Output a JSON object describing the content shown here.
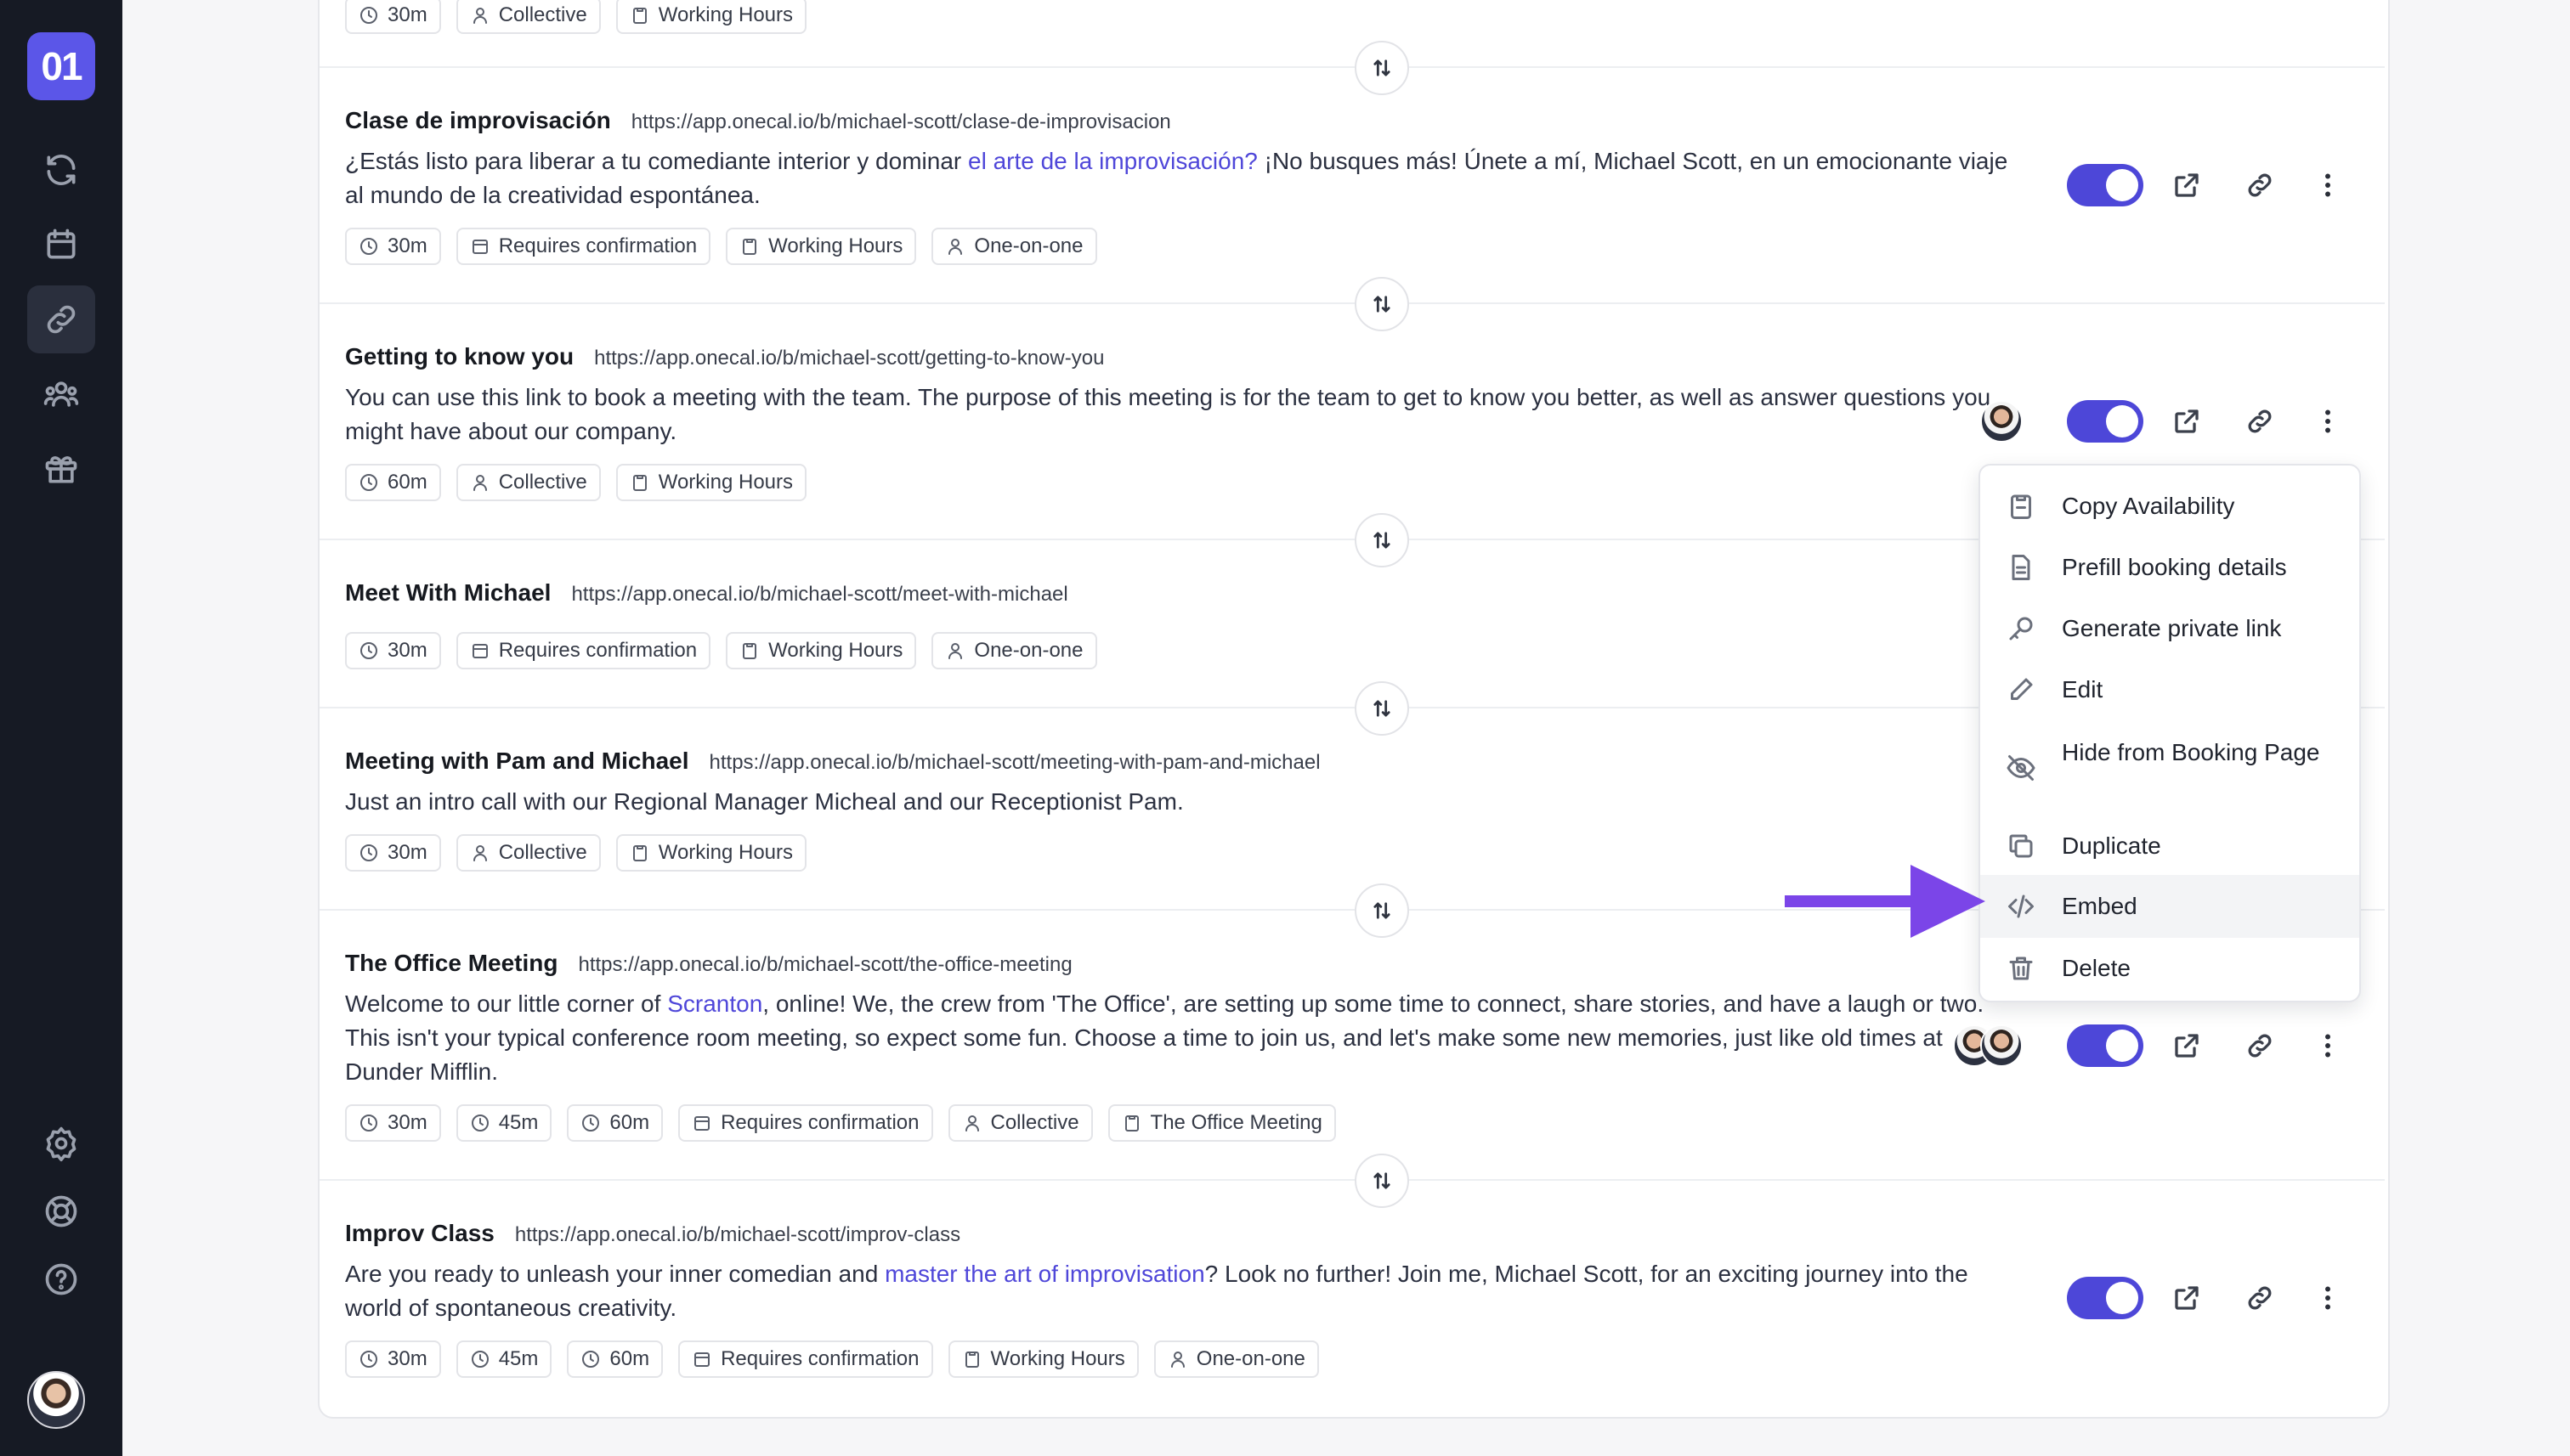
{
  "sidebar": {
    "logo_text": "01",
    "items": [
      {
        "name": "sync",
        "icon": "refresh-icon"
      },
      {
        "name": "calendar",
        "icon": "calendar-icon"
      },
      {
        "name": "links",
        "icon": "link-icon",
        "active": true
      },
      {
        "name": "teams",
        "icon": "users-icon"
      },
      {
        "name": "gifts",
        "icon": "gift-icon"
      }
    ],
    "bottom_items": [
      {
        "name": "settings",
        "icon": "gear-icon"
      },
      {
        "name": "support",
        "icon": "lifebuoy-icon"
      },
      {
        "name": "help",
        "icon": "question-icon"
      }
    ]
  },
  "top_partial_event": {
    "tags": [
      "30m",
      "Collective",
      "Working Hours"
    ]
  },
  "events": [
    {
      "title": "Clase de improvisación",
      "url": "https://app.onecal.io/b/michael-scott/clase-de-improvisacion",
      "desc_1": "¿Estás listo para liberar a tu comediante interior y dominar ",
      "desc_link": "el arte de la improvisación?",
      "desc_2": " ¡No busques más! Únete a mí, Michael Scott, en un emocionante viaje al mundo de la creatividad espontánea.",
      "tags": [
        "30m",
        "Requires confirmation",
        "Working Hours",
        "One-on-one"
      ]
    },
    {
      "title": "Getting to know you",
      "url": "https://app.onecal.io/b/michael-scott/getting-to-know-you",
      "desc_1": "You can use this link to book a meeting with the team. The purpose of this meeting is for the team to get to know you better, as well as answer questions you might have about our company.",
      "tags": [
        "60m",
        "Collective",
        "Working Hours"
      ]
    },
    {
      "title": "Meet With Michael",
      "url": "https://app.onecal.io/b/michael-scott/meet-with-michael",
      "tags": [
        "30m",
        "Requires confirmation",
        "Working Hours",
        "One-on-one"
      ]
    },
    {
      "title": "Meeting with Pam and Michael",
      "url": "https://app.onecal.io/b/michael-scott/meeting-with-pam-and-michael",
      "desc_1": "Just an intro call with our Regional Manager Micheal and our Receptionist Pam.",
      "tags": [
        "30m",
        "Collective",
        "Working Hours"
      ]
    },
    {
      "title": "The Office Meeting",
      "url": "https://app.onecal.io/b/michael-scott/the-office-meeting",
      "desc_1": "Welcome to our little corner of ",
      "desc_link": "Scranton",
      "desc_2": ", online! We, the crew from 'The Office', are setting up some time to connect, share stories, and have a laugh or two. This isn't your typical conference room meeting, so expect some fun. Choose a time to join us, and let's make some new memories, just like old times at Dunder Mifflin.",
      "tags": [
        "30m",
        "45m",
        "60m",
        "Requires confirmation",
        "Collective",
        "The Office Meeting"
      ]
    },
    {
      "title": "Improv Class",
      "url": "https://app.onecal.io/b/michael-scott/improv-class",
      "desc_1": "Are you ready to unleash your inner comedian and ",
      "desc_link": "master the art of improvisation",
      "desc_2": "? Look no further! Join me, Michael Scott, for an exciting journey into the world of spontaneous creativity.",
      "tags": [
        "30m",
        "45m",
        "60m",
        "Requires confirmation",
        "Working Hours",
        "One-on-one"
      ]
    }
  ],
  "context_menu": {
    "items": [
      {
        "label": "Copy Availability",
        "icon": "clipboard-icon"
      },
      {
        "label": "Prefill booking details",
        "icon": "document-icon"
      },
      {
        "label": "Generate private link",
        "icon": "key-icon"
      },
      {
        "label": "Edit",
        "icon": "pencil-icon"
      },
      {
        "label": "Hide from Booking Page",
        "icon": "eye-off-icon"
      },
      {
        "label": "Duplicate",
        "icon": "copy-icon"
      },
      {
        "label": "Embed",
        "icon": "code-icon",
        "highlighted": true
      },
      {
        "label": "Delete",
        "icon": "trash-icon"
      }
    ]
  },
  "colors": {
    "accent": "#4d47d8",
    "sidebar_bg": "#161a24",
    "annotation_arrow": "#7b45e8"
  }
}
